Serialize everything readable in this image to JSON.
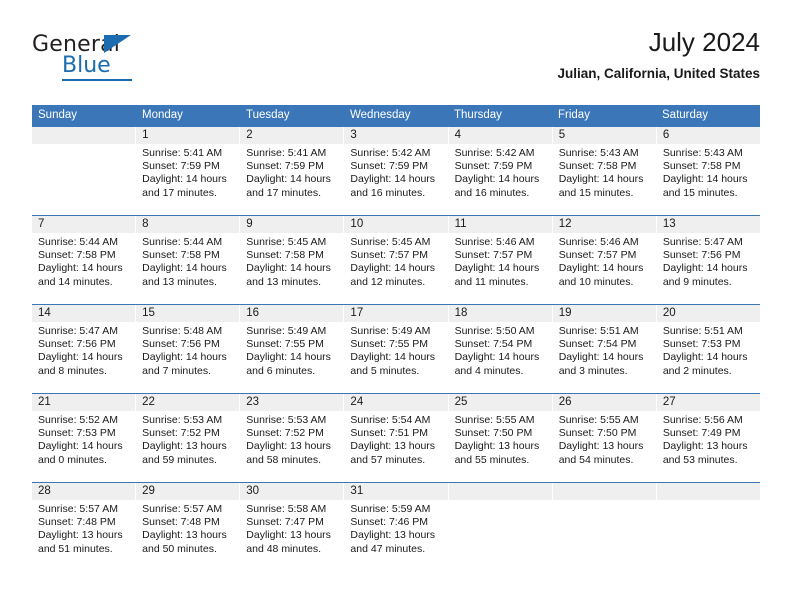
{
  "logo": {
    "word1": "General",
    "word2": "Blue",
    "triangle": "blue-triangle-icon"
  },
  "header": {
    "title": "July 2024",
    "location": "Julian, California, United States"
  },
  "colors": {
    "header_blue": "#3A76B8",
    "logo_blue": "#1B6CB0",
    "daynum_band": "#EFEFEF",
    "text": "#1A1A1A"
  },
  "weekdays": [
    "Sunday",
    "Monday",
    "Tuesday",
    "Wednesday",
    "Thursday",
    "Friday",
    "Saturday"
  ],
  "labels": {
    "sunrise": "Sunrise:",
    "sunset": "Sunset:",
    "daylight": "Daylight:"
  },
  "weeks": [
    [
      {
        "day": "",
        "sunrise": "",
        "sunset": "",
        "daylight_line1": "",
        "daylight_line2": ""
      },
      {
        "day": "1",
        "sunrise": "Sunrise: 5:41 AM",
        "sunset": "Sunset: 7:59 PM",
        "daylight_line1": "Daylight: 14 hours",
        "daylight_line2": "and 17 minutes."
      },
      {
        "day": "2",
        "sunrise": "Sunrise: 5:41 AM",
        "sunset": "Sunset: 7:59 PM",
        "daylight_line1": "Daylight: 14 hours",
        "daylight_line2": "and 17 minutes."
      },
      {
        "day": "3",
        "sunrise": "Sunrise: 5:42 AM",
        "sunset": "Sunset: 7:59 PM",
        "daylight_line1": "Daylight: 14 hours",
        "daylight_line2": "and 16 minutes."
      },
      {
        "day": "4",
        "sunrise": "Sunrise: 5:42 AM",
        "sunset": "Sunset: 7:59 PM",
        "daylight_line1": "Daylight: 14 hours",
        "daylight_line2": "and 16 minutes."
      },
      {
        "day": "5",
        "sunrise": "Sunrise: 5:43 AM",
        "sunset": "Sunset: 7:58 PM",
        "daylight_line1": "Daylight: 14 hours",
        "daylight_line2": "and 15 minutes."
      },
      {
        "day": "6",
        "sunrise": "Sunrise: 5:43 AM",
        "sunset": "Sunset: 7:58 PM",
        "daylight_line1": "Daylight: 14 hours",
        "daylight_line2": "and 15 minutes."
      }
    ],
    [
      {
        "day": "7",
        "sunrise": "Sunrise: 5:44 AM",
        "sunset": "Sunset: 7:58 PM",
        "daylight_line1": "Daylight: 14 hours",
        "daylight_line2": "and 14 minutes."
      },
      {
        "day": "8",
        "sunrise": "Sunrise: 5:44 AM",
        "sunset": "Sunset: 7:58 PM",
        "daylight_line1": "Daylight: 14 hours",
        "daylight_line2": "and 13 minutes."
      },
      {
        "day": "9",
        "sunrise": "Sunrise: 5:45 AM",
        "sunset": "Sunset: 7:58 PM",
        "daylight_line1": "Daylight: 14 hours",
        "daylight_line2": "and 13 minutes."
      },
      {
        "day": "10",
        "sunrise": "Sunrise: 5:45 AM",
        "sunset": "Sunset: 7:57 PM",
        "daylight_line1": "Daylight: 14 hours",
        "daylight_line2": "and 12 minutes."
      },
      {
        "day": "11",
        "sunrise": "Sunrise: 5:46 AM",
        "sunset": "Sunset: 7:57 PM",
        "daylight_line1": "Daylight: 14 hours",
        "daylight_line2": "and 11 minutes."
      },
      {
        "day": "12",
        "sunrise": "Sunrise: 5:46 AM",
        "sunset": "Sunset: 7:57 PM",
        "daylight_line1": "Daylight: 14 hours",
        "daylight_line2": "and 10 minutes."
      },
      {
        "day": "13",
        "sunrise": "Sunrise: 5:47 AM",
        "sunset": "Sunset: 7:56 PM",
        "daylight_line1": "Daylight: 14 hours",
        "daylight_line2": "and 9 minutes."
      }
    ],
    [
      {
        "day": "14",
        "sunrise": "Sunrise: 5:47 AM",
        "sunset": "Sunset: 7:56 PM",
        "daylight_line1": "Daylight: 14 hours",
        "daylight_line2": "and 8 minutes."
      },
      {
        "day": "15",
        "sunrise": "Sunrise: 5:48 AM",
        "sunset": "Sunset: 7:56 PM",
        "daylight_line1": "Daylight: 14 hours",
        "daylight_line2": "and 7 minutes."
      },
      {
        "day": "16",
        "sunrise": "Sunrise: 5:49 AM",
        "sunset": "Sunset: 7:55 PM",
        "daylight_line1": "Daylight: 14 hours",
        "daylight_line2": "and 6 minutes."
      },
      {
        "day": "17",
        "sunrise": "Sunrise: 5:49 AM",
        "sunset": "Sunset: 7:55 PM",
        "daylight_line1": "Daylight: 14 hours",
        "daylight_line2": "and 5 minutes."
      },
      {
        "day": "18",
        "sunrise": "Sunrise: 5:50 AM",
        "sunset": "Sunset: 7:54 PM",
        "daylight_line1": "Daylight: 14 hours",
        "daylight_line2": "and 4 minutes."
      },
      {
        "day": "19",
        "sunrise": "Sunrise: 5:51 AM",
        "sunset": "Sunset: 7:54 PM",
        "daylight_line1": "Daylight: 14 hours",
        "daylight_line2": "and 3 minutes."
      },
      {
        "day": "20",
        "sunrise": "Sunrise: 5:51 AM",
        "sunset": "Sunset: 7:53 PM",
        "daylight_line1": "Daylight: 14 hours",
        "daylight_line2": "and 2 minutes."
      }
    ],
    [
      {
        "day": "21",
        "sunrise": "Sunrise: 5:52 AM",
        "sunset": "Sunset: 7:53 PM",
        "daylight_line1": "Daylight: 14 hours",
        "daylight_line2": "and 0 minutes."
      },
      {
        "day": "22",
        "sunrise": "Sunrise: 5:53 AM",
        "sunset": "Sunset: 7:52 PM",
        "daylight_line1": "Daylight: 13 hours",
        "daylight_line2": "and 59 minutes."
      },
      {
        "day": "23",
        "sunrise": "Sunrise: 5:53 AM",
        "sunset": "Sunset: 7:52 PM",
        "daylight_line1": "Daylight: 13 hours",
        "daylight_line2": "and 58 minutes."
      },
      {
        "day": "24",
        "sunrise": "Sunrise: 5:54 AM",
        "sunset": "Sunset: 7:51 PM",
        "daylight_line1": "Daylight: 13 hours",
        "daylight_line2": "and 57 minutes."
      },
      {
        "day": "25",
        "sunrise": "Sunrise: 5:55 AM",
        "sunset": "Sunset: 7:50 PM",
        "daylight_line1": "Daylight: 13 hours",
        "daylight_line2": "and 55 minutes."
      },
      {
        "day": "26",
        "sunrise": "Sunrise: 5:55 AM",
        "sunset": "Sunset: 7:50 PM",
        "daylight_line1": "Daylight: 13 hours",
        "daylight_line2": "and 54 minutes."
      },
      {
        "day": "27",
        "sunrise": "Sunrise: 5:56 AM",
        "sunset": "Sunset: 7:49 PM",
        "daylight_line1": "Daylight: 13 hours",
        "daylight_line2": "and 53 minutes."
      }
    ],
    [
      {
        "day": "28",
        "sunrise": "Sunrise: 5:57 AM",
        "sunset": "Sunset: 7:48 PM",
        "daylight_line1": "Daylight: 13 hours",
        "daylight_line2": "and 51 minutes."
      },
      {
        "day": "29",
        "sunrise": "Sunrise: 5:57 AM",
        "sunset": "Sunset: 7:48 PM",
        "daylight_line1": "Daylight: 13 hours",
        "daylight_line2": "and 50 minutes."
      },
      {
        "day": "30",
        "sunrise": "Sunrise: 5:58 AM",
        "sunset": "Sunset: 7:47 PM",
        "daylight_line1": "Daylight: 13 hours",
        "daylight_line2": "and 48 minutes."
      },
      {
        "day": "31",
        "sunrise": "Sunrise: 5:59 AM",
        "sunset": "Sunset: 7:46 PM",
        "daylight_line1": "Daylight: 13 hours",
        "daylight_line2": "and 47 minutes."
      },
      {
        "day": "",
        "sunrise": "",
        "sunset": "",
        "daylight_line1": "",
        "daylight_line2": ""
      },
      {
        "day": "",
        "sunrise": "",
        "sunset": "",
        "daylight_line1": "",
        "daylight_line2": ""
      },
      {
        "day": "",
        "sunrise": "",
        "sunset": "",
        "daylight_line1": "",
        "daylight_line2": ""
      }
    ]
  ]
}
